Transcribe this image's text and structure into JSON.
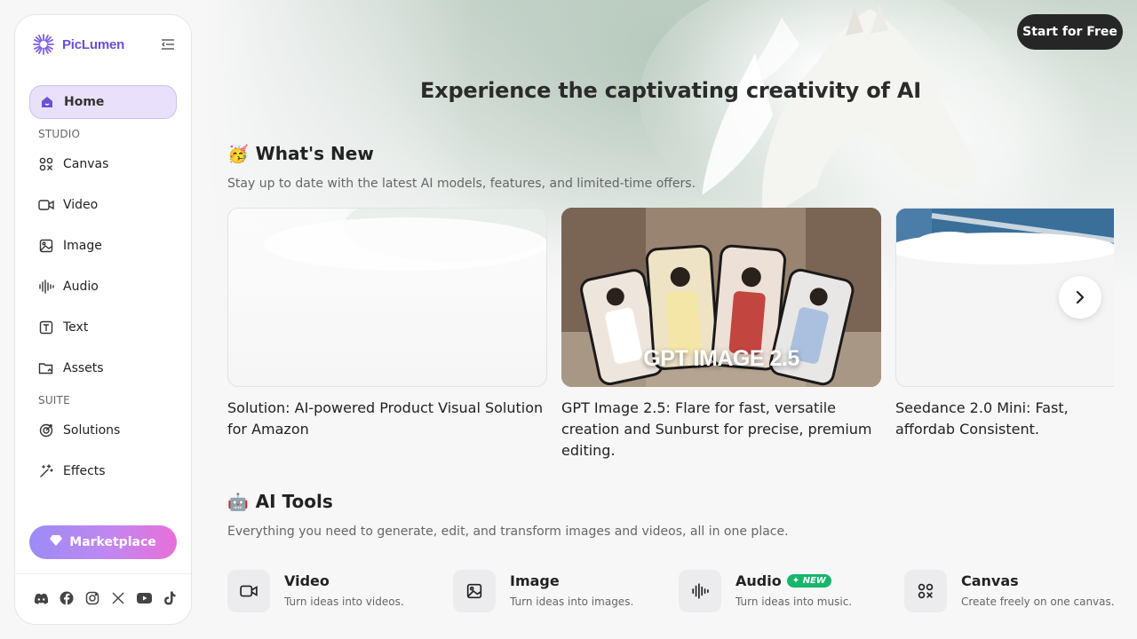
{
  "brand": {
    "name": "PicLumen",
    "accent": "#6b4fd8"
  },
  "sidebar": {
    "home_label": "Home",
    "studio_label": "STUDIO",
    "studio_items": [
      {
        "label": "Canvas",
        "icon": "canvas-icon"
      },
      {
        "label": "Video",
        "icon": "video-icon"
      },
      {
        "label": "Image",
        "icon": "image-icon"
      },
      {
        "label": "Audio",
        "icon": "audio-icon"
      },
      {
        "label": "Text",
        "icon": "text-icon"
      },
      {
        "label": "Assets",
        "icon": "folder-icon"
      }
    ],
    "suite_label": "SUITE",
    "suite_items": [
      {
        "label": "Solutions",
        "icon": "target-icon"
      },
      {
        "label": "Effects",
        "icon": "magic-wand-icon"
      }
    ],
    "marketplace_label": "Marketplace",
    "socials": [
      "discord-icon",
      "facebook-icon",
      "instagram-icon",
      "x-icon",
      "youtube-icon",
      "tiktok-icon"
    ]
  },
  "header": {
    "cta_label": "Start for Free"
  },
  "hero": {
    "title": "Experience the captivating creativity of AI"
  },
  "whats_new": {
    "emoji": "🥳",
    "title": "What's New",
    "subtitle": "Stay up to date with the latest AI models, features, and limited-time offers.",
    "cards": [
      {
        "caption": "Solution: AI-powered Product Visual Solution for Amazon"
      },
      {
        "caption": "GPT Image 2.5: Flare for fast, versatile creation and Sunburst for precise, premium editing.",
        "image_text": "GPT IMAGE 2.5"
      },
      {
        "caption": "Seedance 2.0 Mini: Fast, affordab Consistent."
      }
    ]
  },
  "ai_tools": {
    "emoji": "🤖",
    "title": "AI Tools",
    "subtitle": "Everything you need to generate, edit, and transform images and videos, all in one place.",
    "items": [
      {
        "name": "Video",
        "desc": "Turn ideas into videos.",
        "icon": "video-icon"
      },
      {
        "name": "Image",
        "desc": "Turn ideas into images.",
        "icon": "image-icon"
      },
      {
        "name": "Audio",
        "desc": "Turn ideas into music.",
        "icon": "audio-icon",
        "badge": "NEW"
      },
      {
        "name": "Canvas",
        "desc": "Create freely on one canvas.",
        "icon": "canvas-icon"
      }
    ]
  }
}
